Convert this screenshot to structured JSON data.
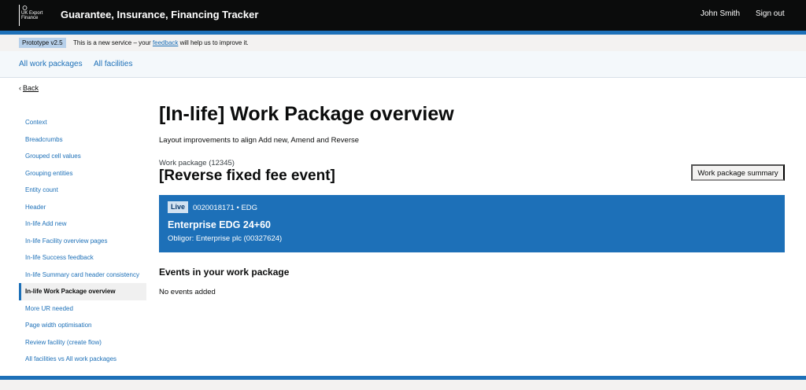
{
  "header": {
    "logo_text": "UK Export Finance",
    "service_name": "Guarantee, Insurance, Financing Tracker",
    "user_name": "John Smith",
    "sign_out": "Sign out"
  },
  "phase_banner": {
    "tag": "Prototype v2.5",
    "text_before": "This is a new service – your ",
    "link": "feedback",
    "text_after": " will help us to improve it."
  },
  "subnav": {
    "items": [
      {
        "label": "All work packages"
      },
      {
        "label": "All facilities"
      }
    ]
  },
  "back_link": "Back",
  "sidenav": {
    "items": [
      {
        "label": "Context"
      },
      {
        "label": "Breadcrumbs"
      },
      {
        "label": "Grouped cell values"
      },
      {
        "label": "Grouping entities"
      },
      {
        "label": "Entity count"
      },
      {
        "label": "Header"
      },
      {
        "label": "In-life Add new"
      },
      {
        "label": "In-life Facility overview pages"
      },
      {
        "label": "In-life Success feedback"
      },
      {
        "label": "In-life Summary card header consistency"
      },
      {
        "label": "In-life Work Package overview",
        "active": true
      },
      {
        "label": "More UR needed"
      },
      {
        "label": "Page width optimisation"
      },
      {
        "label": "Review facility (create flow)"
      },
      {
        "label": "All facilities vs All work packages"
      }
    ]
  },
  "main": {
    "title": "[In-life] Work Package overview",
    "lede": "Layout improvements to align Add new, Amend and Reverse",
    "caption": "Work package (12345)",
    "heading": "[Reverse fixed fee event]",
    "summary_button": "Work package summary",
    "facility": {
      "status": "Live",
      "id": "0020018171 • EDG",
      "name": "Enterprise EDG 24+60",
      "obligor": "Obligor: Enterprise plc (00327624)"
    },
    "events_heading": "Events in your work package",
    "events_empty": "No events added"
  },
  "colors": {
    "header_bg": "#0b0c0c",
    "brand_blue": "#1d70b8",
    "phase_tag_bg": "#b7d0ea",
    "subnav_bg": "#f4f8fb"
  }
}
